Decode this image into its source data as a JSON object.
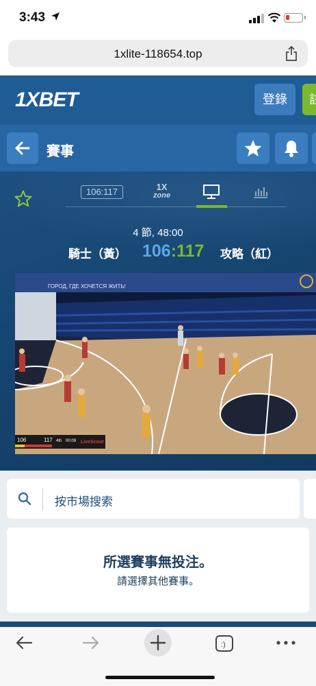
{
  "status": {
    "time": "3:43",
    "location_icon": "location-arrow-icon"
  },
  "browser": {
    "url": "1xlite-118654.top"
  },
  "site": {
    "logo": "1XBET",
    "login_label": "登錄",
    "register_label": "註"
  },
  "subheader": {
    "title": "賽事"
  },
  "game": {
    "tabs": [
      {
        "name": "scoreboard",
        "label": "106:117"
      },
      {
        "name": "1x-zone",
        "label_top": "1X",
        "label_bottom": "zone"
      },
      {
        "name": "video",
        "active": true
      },
      {
        "name": "statistics"
      }
    ],
    "period": "4 節, 48:00",
    "home_team": "騎士（黃）",
    "away_team": "攻略（紅）",
    "home_score": "106",
    "separator": ":",
    "away_score": "117"
  },
  "video": {
    "banner_text": "ГОРОД, ГДЕ ХОЧЕТСЯ ЖИТЬ!",
    "hud": {
      "home": "106",
      "away": "117",
      "quarter": "4th",
      "clock": "00:09",
      "brand": "LiveScout"
    }
  },
  "search": {
    "placeholder": "按市場搜索"
  },
  "empty_state": {
    "title": "所選賽事無投注。",
    "subtitle": "請選擇其他賽事。"
  },
  "colors": {
    "brand_blue": "#1f5c94",
    "accent_green": "#7ab92f",
    "score_blue": "#5aa7e6"
  }
}
